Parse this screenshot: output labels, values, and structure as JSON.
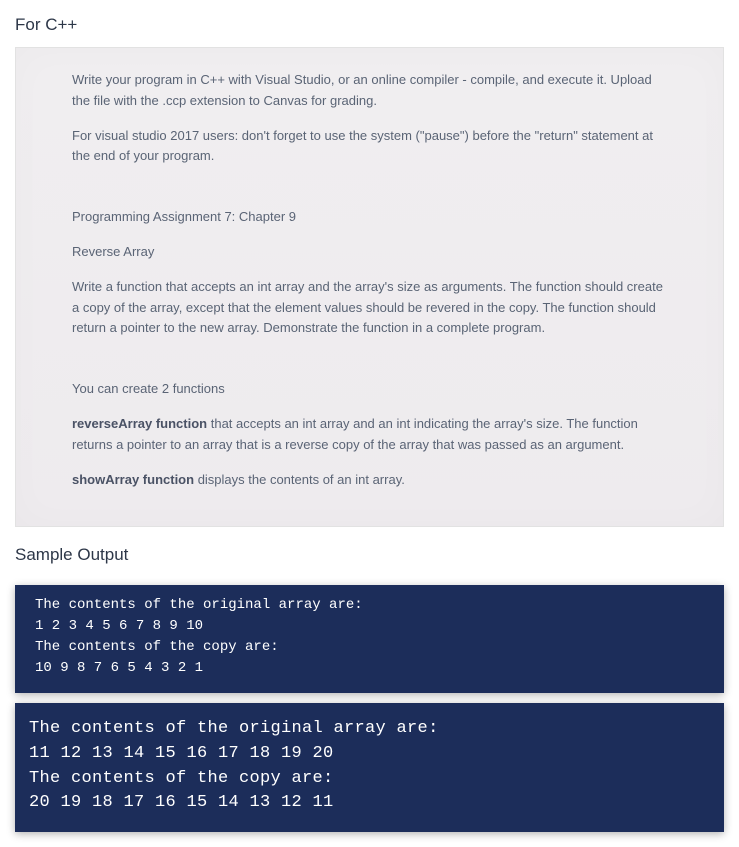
{
  "heading_cpp": "For C++",
  "assignment": {
    "intro1": "Write your program in C++ with Visual Studio, or an online compiler - compile, and execute it. Upload the file with the .ccp extension to Canvas for grading.",
    "intro2": "For visual studio 2017 users: don't forget to use the system (\"pause\")  before the \"return\" statement at the end of your program.",
    "title": "Programming Assignment 7: Chapter 9",
    "subtitle": "Reverse Array",
    "desc": "Write a function that accepts an int array and the array's size as arguments. The function should create a copy of the array, except that the element values should be revered in the copy. The function should return a pointer to the new array. Demonstrate the function in a complete program.",
    "funcs_intro": "You can create 2 functions",
    "func1_label": "reverseArray function",
    "func1_desc": " that accepts an int array and an int indicating the array's size. The function returns  a pointer to an array that is a reverse copy of the  array that was passed as an argument.",
    "func2_label": "showArray function",
    "func2_desc": " displays the contents of an int array."
  },
  "sample_heading": "Sample Output",
  "terminal1": {
    "line1": "The contents of the original array are:",
    "line2": "1 2 3 4 5 6 7 8 9 10",
    "line3": "The contents of the copy are:",
    "line4": "10 9 8 7 6 5 4 3 2 1"
  },
  "terminal2": {
    "line1": "The contents of the original array are:",
    "line2": "11 12 13 14 15 16 17 18 19 20",
    "line3": "The contents of the copy are:",
    "line4": "20 19 18 17 16 15 14 13 12 11"
  }
}
